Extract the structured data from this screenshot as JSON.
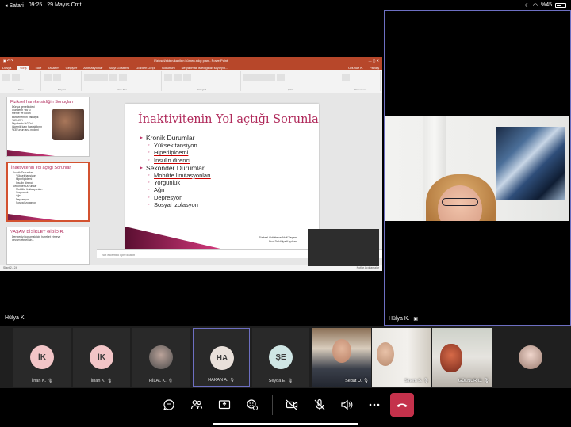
{
  "status_bar": {
    "carrier": "◂ Safari",
    "time": "09:25",
    "date": "29 Mayıs Cmt",
    "battery": "%45"
  },
  "main_tile": {
    "name": "Hülya K."
  },
  "speaker_tile": {
    "name": "Hülya K."
  },
  "ppt": {
    "window_title": "Fiziksel/akten-kabilen kümen adıp plan - PowerPoint",
    "tabs": [
      "Dosya",
      "Giriş",
      "Ekle",
      "Tasarım",
      "Geçişler",
      "Animasyonlar",
      "Slayt Gösterisi",
      "Gözden Geçir",
      "Görünüm",
      "Ne yapmak istediğinizi söyleyin..."
    ],
    "active_tab": "Giriş",
    "user": "Obunuz K.",
    "share": "Paylaş",
    "ribbon_groups": [
      "Pano",
      "Slaytlar",
      "Yazı Tipi",
      "Paragraf",
      "Çizim",
      "Düzenleme"
    ],
    "notes_placeholder": "Not eklemek için tıklatın",
    "status_left": "Slayt 2 / 24",
    "status_right": "Notlar  Açıklamalar",
    "slide": {
      "title": "İnaktivitenin Yol açtığı Sorunlar",
      "items": [
        {
          "level": 1,
          "text": "Kronik Durumlar"
        },
        {
          "level": 2,
          "text": "Yüksek tansiyon"
        },
        {
          "level": 2,
          "text": "Hiperlipidemi"
        },
        {
          "level": 2,
          "text": "Insulin direnci"
        },
        {
          "level": 1,
          "text": "Sekonder Durumlar"
        },
        {
          "level": 2,
          "text": "Mobilite  limitasyonları"
        },
        {
          "level": 2,
          "text": "Yorgunluk"
        },
        {
          "level": 2,
          "text": "Ağrı"
        },
        {
          "level": 2,
          "text": "Depresyon"
        },
        {
          "level": 2,
          "text": "Sosyal izolasyon"
        }
      ],
      "footer_line1": "Fiziksel Aktivite ve Aktif Yaşam",
      "footer_line2": "Prof Dr Hülya Kayıhan"
    },
    "thumbnails": [
      {
        "title": "Fiziksel hareketsizliğin Sonuçları",
        "lines": [
          "Dünya genelindeki",
          "ölümlerin %6'sı",
          "Meme ve kolon",
          "kanserlerinin yaklaşık",
          "%21-25'i",
          "Diyabetin %27'si",
          "iskemik kalp hastalığının",
          "%30'unun ana nedeni"
        ]
      },
      {
        "title": "İnaktivitenin Yol açtığı Sorunlar",
        "lines": [
          "Kronik Durumlar",
          "Yüksek tansiyon",
          "Hiperlipidemi",
          "Insulin direnci",
          "Sekonder Durumlar",
          "Mobilite limitasyonları",
          "Yorgunluk",
          "Ağrı",
          "Depresyon",
          "Sosyal izolasyon"
        ]
      },
      {
        "title": "YAŞAM BİSİKLET GİBİDİR.",
        "lines": [
          "Dengenizi korumak için hareket etmeye",
          "devam etmelisin..."
        ]
      }
    ]
  },
  "participants": [
    {
      "initials": "İK",
      "name": "İlhan K.",
      "color": "#f2c5c7"
    },
    {
      "initials": "İK",
      "name": "İlhan K.",
      "color": "#f2c5c7"
    },
    {
      "initials": "",
      "name": "HİLAL K.",
      "color": ""
    },
    {
      "initials": "HA",
      "name": "HAKAN A.",
      "color": "#e9e0da"
    },
    {
      "initials": "ŞE",
      "name": "Şeyda E.",
      "color": "#cfe6e4"
    }
  ],
  "video_participants": [
    {
      "name": "Sedat U."
    },
    {
      "name": "Sinem S."
    },
    {
      "name": "GÜLNUR O."
    }
  ],
  "toolbar": {
    "buttons": [
      "chat",
      "participants",
      "share",
      "reactions",
      "camera",
      "mic",
      "speaker",
      "more",
      "leave"
    ]
  }
}
